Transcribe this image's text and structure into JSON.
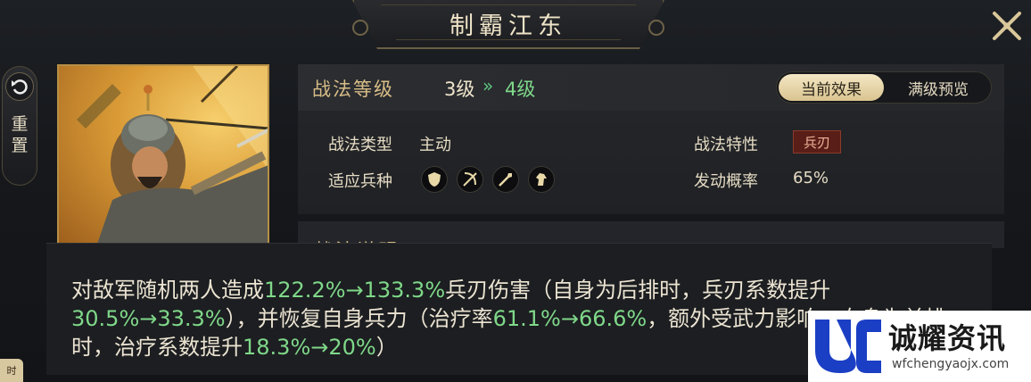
{
  "window": {
    "title": "制霸江东"
  },
  "reset": {
    "label": "重置"
  },
  "level": {
    "label": "战法等级",
    "current": "3级",
    "arrow": "»",
    "next": "4级"
  },
  "toggle": {
    "current": "当前效果",
    "max": "满级预览"
  },
  "info": {
    "type_label": "战法类型",
    "type_value": "主动",
    "trait_label": "战法特性",
    "trait_value": "兵刃",
    "troop_label": "适应兵种",
    "troops": [
      "shield-icon",
      "bow-icon",
      "spear-icon",
      "horse-icon"
    ],
    "chance_label": "发动概率",
    "chance_value": "65%"
  },
  "description": {
    "header": "战法说明",
    "p1": "对敌军随机两人造成",
    "v1": "122.2%→133.3%",
    "p2": "兵刃伤害（自身为后排时，兵刃系数提升",
    "v2": "30.5%→33.3%",
    "p3": "），并恢复自身兵力（治疗率",
    "v3": "61.1%→66.6%",
    "p4": "，额外受武力影响，自身为前排时，治疗系数提升",
    "v4": "18.3%→20%",
    "p5": "）"
  },
  "watermark": {
    "title": "诚耀资讯",
    "url": "wfchengyaojx.com"
  },
  "corner_tab": "时",
  "colors": {
    "gold": "#d8bd86",
    "green": "#7fd889",
    "badge_red": "#5a1e18",
    "frame": "#b68f46"
  }
}
